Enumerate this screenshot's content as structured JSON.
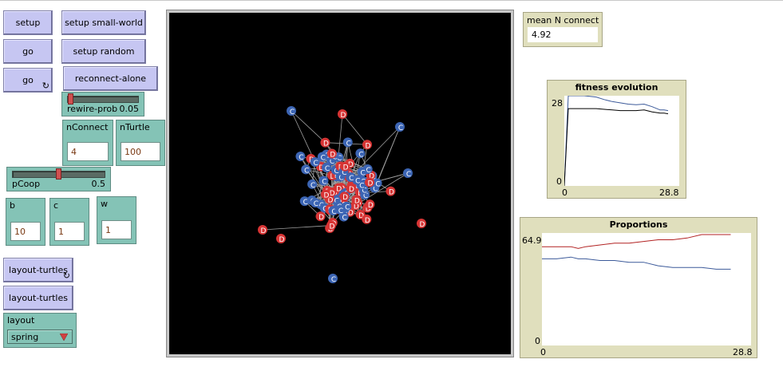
{
  "buttons": {
    "setup": "setup",
    "setup_small_world": "setup small-world",
    "go": "go",
    "setup_random": "setup random",
    "go_forever": "go",
    "reconnect_alone": "reconnect-alone",
    "layout_turtles_forever": "layout-turtles",
    "layout_turtles": "layout-turtles"
  },
  "sliders": {
    "rewire_prob": {
      "label": "rewire-prob",
      "value": "0.05",
      "position": 0.05
    },
    "pcoop": {
      "label": "pCoop",
      "value": "0.5",
      "position": 0.5
    }
  },
  "inputs": {
    "nconnect": {
      "label": "nConnect",
      "value": "4"
    },
    "nturtle": {
      "label": "nTurtle",
      "value": "100"
    },
    "b": {
      "label": "b",
      "value": "10"
    },
    "c": {
      "label": "c",
      "value": "1"
    },
    "w": {
      "label": "w",
      "value": "1"
    }
  },
  "chooser": {
    "label": "layout",
    "value": "spring"
  },
  "monitor": {
    "label": "mean N connect",
    "value": "4.92"
  },
  "world": {
    "background": "#000000",
    "cooperator_color": "#3c65b4",
    "defector_color": "#d73434",
    "cooperator_label": "C",
    "defector_label": "D",
    "link_color": "#a0a0a0"
  },
  "fitness_plot": {
    "title": "fitness evolution",
    "y_max_label": "28",
    "y_min_label": "0",
    "x_min_label": "0",
    "x_max_label": "28.8",
    "chart_data": {
      "type": "line",
      "xlim": [
        0,
        28.8
      ],
      "ylim": [
        0,
        28
      ],
      "series": [
        {
          "color": "#3c5a9a",
          "x": [
            0,
            1,
            3,
            5,
            8,
            10,
            12,
            14,
            16,
            18,
            20,
            22,
            24,
            25,
            26
          ],
          "y": [
            0,
            28,
            28,
            28,
            27.6,
            26.8,
            26.2,
            25.8,
            25.4,
            25.2,
            25.4,
            24.6,
            23.6,
            23.6,
            23.4
          ]
        },
        {
          "color": "#000000",
          "x": [
            0,
            1,
            3,
            5,
            8,
            10,
            12,
            14,
            16,
            18,
            20,
            22,
            24,
            25,
            26
          ],
          "y": [
            0,
            24,
            24,
            24,
            24,
            23.8,
            23.6,
            23.4,
            23.4,
            23.4,
            23.6,
            23,
            22.6,
            22.6,
            22.4
          ]
        }
      ]
    }
  },
  "prop_plot": {
    "title": "Proportions",
    "y_max_label": "64.9",
    "y_min_label": "0",
    "x_min_label": "0",
    "x_max_label": "28.8",
    "chart_data": {
      "type": "line",
      "xlim": [
        0,
        28.8
      ],
      "ylim": [
        0,
        64.9
      ],
      "series": [
        {
          "color": "#b22222",
          "x": [
            0,
            2,
            4,
            5,
            6,
            8,
            10,
            12,
            14,
            16,
            18,
            20,
            22,
            24,
            26
          ],
          "y": [
            57,
            57,
            57,
            56,
            57,
            58,
            59,
            59,
            60,
            61,
            61,
            62,
            64,
            64,
            64
          ]
        },
        {
          "color": "#3c5a9a",
          "x": [
            0,
            2,
            4,
            5,
            6,
            8,
            10,
            12,
            14,
            16,
            18,
            20,
            22,
            24,
            26
          ],
          "y": [
            50,
            50,
            51,
            50,
            50,
            49,
            49,
            48,
            48,
            46,
            45,
            45,
            45,
            44,
            44
          ]
        }
      ]
    }
  }
}
